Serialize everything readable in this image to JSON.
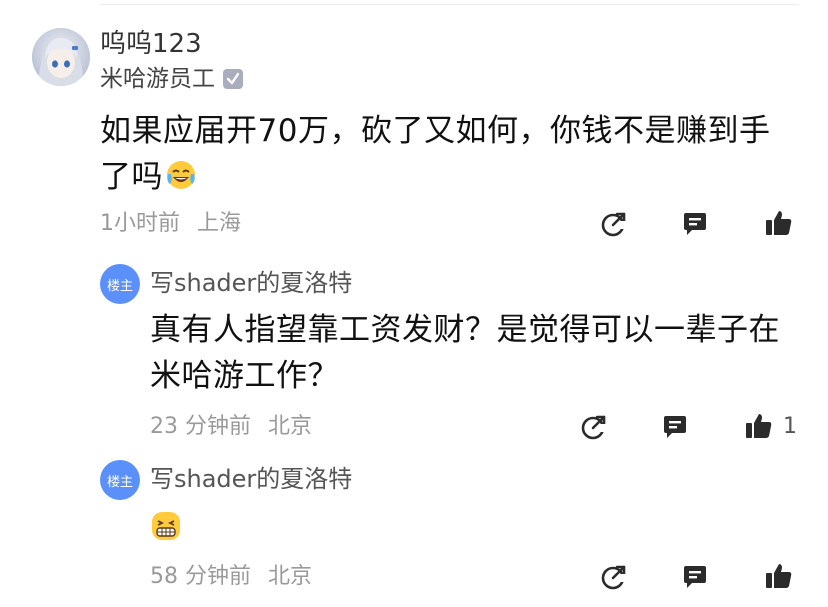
{
  "comment": {
    "username": "呜呜123",
    "title": "米哈游员工",
    "content": "如果应届开70万，砍了又如何，你钱不是赚到手了吗",
    "emoji_icon": "laughing-tears-emoji",
    "time": "1小时前",
    "location": "上海"
  },
  "replies": [
    {
      "badge": "楼主",
      "author": "写shader的夏洛特",
      "content": "真有人指望靠工资发财？是觉得可以一辈子在米哈游工作？",
      "time": "23 分钟前",
      "location": "北京",
      "likes": "1"
    },
    {
      "badge": "楼主",
      "author": "写shader的夏洛特",
      "emoji_icon": "grinning-teeth-emoji",
      "time": "58 分钟前",
      "location": "北京"
    }
  ],
  "icons": {
    "share": "share-icon",
    "reply": "reply-icon",
    "like": "thumbs-up-icon"
  },
  "colors": {
    "badge_blue": "#5b8ff9",
    "meta_gray": "#9a9a9a",
    "icon_dark": "#2b2b2b"
  }
}
